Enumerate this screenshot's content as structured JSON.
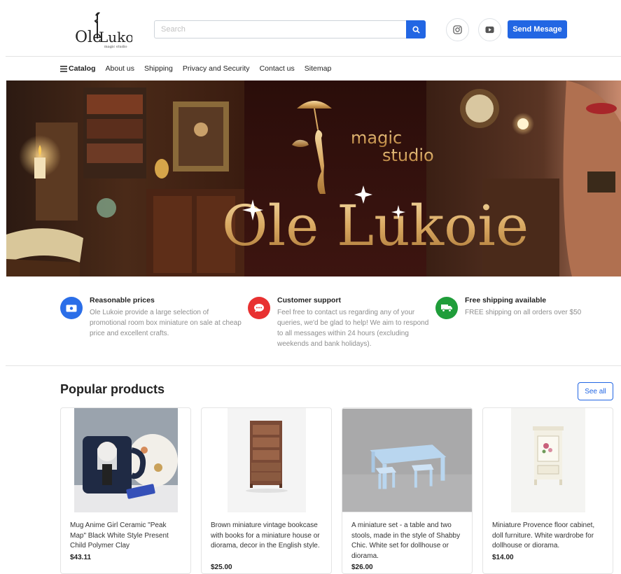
{
  "header": {
    "logo_text": "Ole Lukoie",
    "logo_subtext": "magic studio",
    "search_placeholder": "Search",
    "send_message_label": "Send Mesage"
  },
  "nav": {
    "catalog": "Catalog",
    "items": [
      "About us",
      "Shipping",
      "Privacy and Security",
      "Contact us",
      "Sitemap"
    ]
  },
  "banner": {
    "subtitle_line1": "magic",
    "subtitle_line2": "studio",
    "title": "Ole Lukoie"
  },
  "features": [
    {
      "title": "Reasonable prices",
      "text": "Ole Lukoie provide a large selection of promotional room box miniature on sale at cheap price and excellent crafts.",
      "icon": "money-icon",
      "color": "#2b6ee8"
    },
    {
      "title": "Customer support",
      "text": "Feel free to contact us regarding any of your queries, we'd be glad to help! We aim to respond to all messages within 24 hours (excluding weekends and bank holidays).",
      "icon": "chat-icon",
      "color": "#e83131"
    },
    {
      "title": "Free shipping available",
      "text": "FREE shipping on all orders over $50",
      "icon": "truck-icon",
      "color": "#1f9d3a"
    }
  ],
  "popular": {
    "title": "Popular products",
    "see_all": "See all",
    "products": [
      {
        "name": "Mug Anime Girl Ceramic \"Peak Map\" Black White Style Present Child Polymer Clay",
        "price": "$43.11"
      },
      {
        "name": "Brown miniature vintage bookcase with books for a miniature house or diorama, decor in the English style.",
        "price": "$25.00"
      },
      {
        "name": "A miniature set - a table and two stools, made in the style of Shabby Chic. White set for dollhouse or diorama.",
        "price": "$26.00"
      },
      {
        "name": "Miniature Provence floor cabinet, doll furniture. White wardrobe for dollhouse or diorama.",
        "price": "$14.00"
      }
    ]
  },
  "colors": {
    "primary": "#2266e3",
    "text": "#222222",
    "muted": "#8e8e8e"
  }
}
